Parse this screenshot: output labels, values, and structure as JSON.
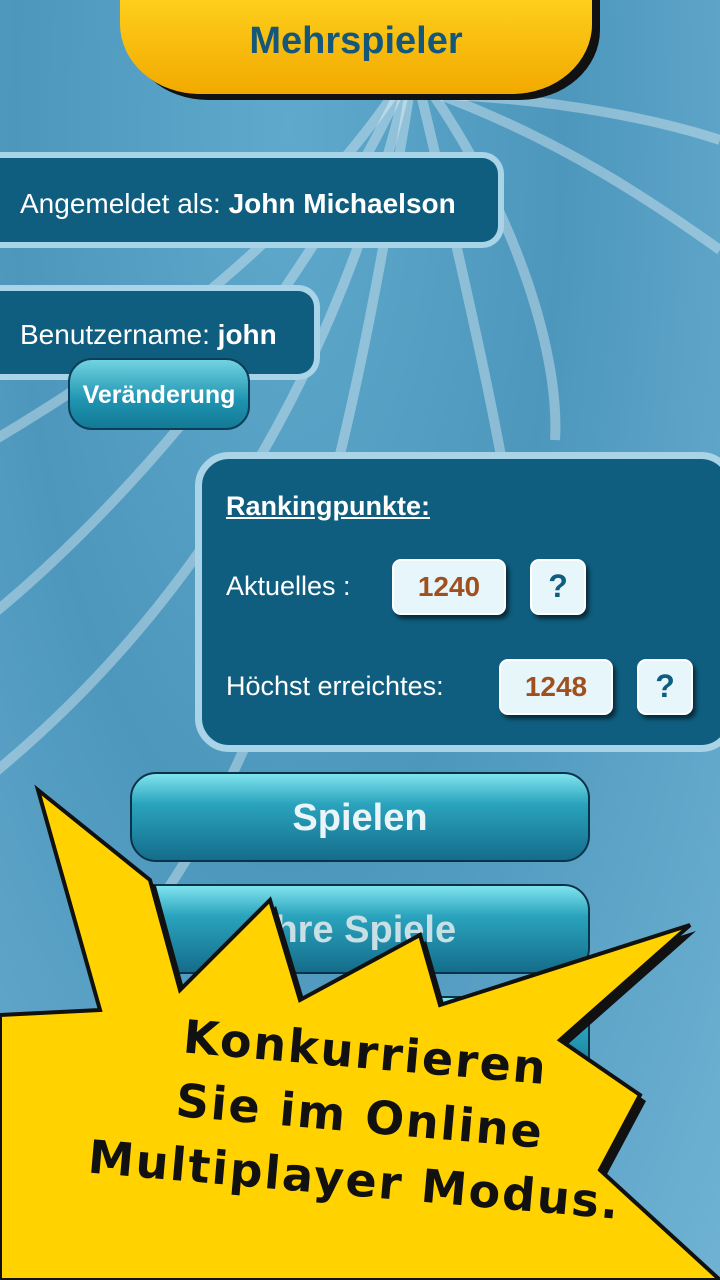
{
  "header": {
    "title": "Mehrspieler"
  },
  "account": {
    "logged_in_label": "Angemeldet als:",
    "logged_in_name": "John Michaelson",
    "username_label": "Benutzername:",
    "username_value": "john",
    "change_button": "Veränderung"
  },
  "ranking": {
    "title": "Rankingpunkte:",
    "current_label": "Aktuelles :",
    "current_value": "1240",
    "highest_label": "Höchst erreichtes:",
    "highest_value": "1248",
    "help_symbol": "?"
  },
  "menu": {
    "play": "Spielen",
    "my_games": "Ihre Spiele"
  },
  "promo": {
    "lines": [
      "Konkurrieren",
      "Sie im Online",
      "Multiplayer Modus."
    ]
  },
  "colors": {
    "header_gold": "#ffd21e",
    "panel_teal": "#0f5e7f",
    "value_text": "#a04f1e",
    "burst_yellow": "#ffd200"
  }
}
